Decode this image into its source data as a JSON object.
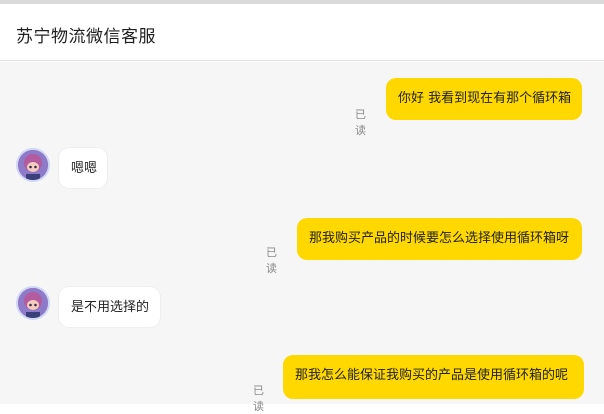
{
  "header": {
    "title": "苏宁物流微信客服"
  },
  "messages": [
    {
      "side": "out",
      "text": "你好 我看到现在有那个循环箱",
      "read": "已读"
    },
    {
      "side": "in",
      "text": "嗯嗯"
    },
    {
      "side": "out",
      "text": "那我购买产品的时候要怎么选择使用循环箱呀",
      "read": "已读"
    },
    {
      "side": "in",
      "text": "是不用选择的"
    },
    {
      "side": "out",
      "text": "那我怎么能保证我购买的产品是使用循环箱的呢",
      "read": "已读"
    }
  ],
  "colors": {
    "outgoing_bubble": "#ffd800",
    "background": "#f6f6f6"
  },
  "icons": {
    "agent_avatar": "cartoon-agent-avatar-icon"
  }
}
